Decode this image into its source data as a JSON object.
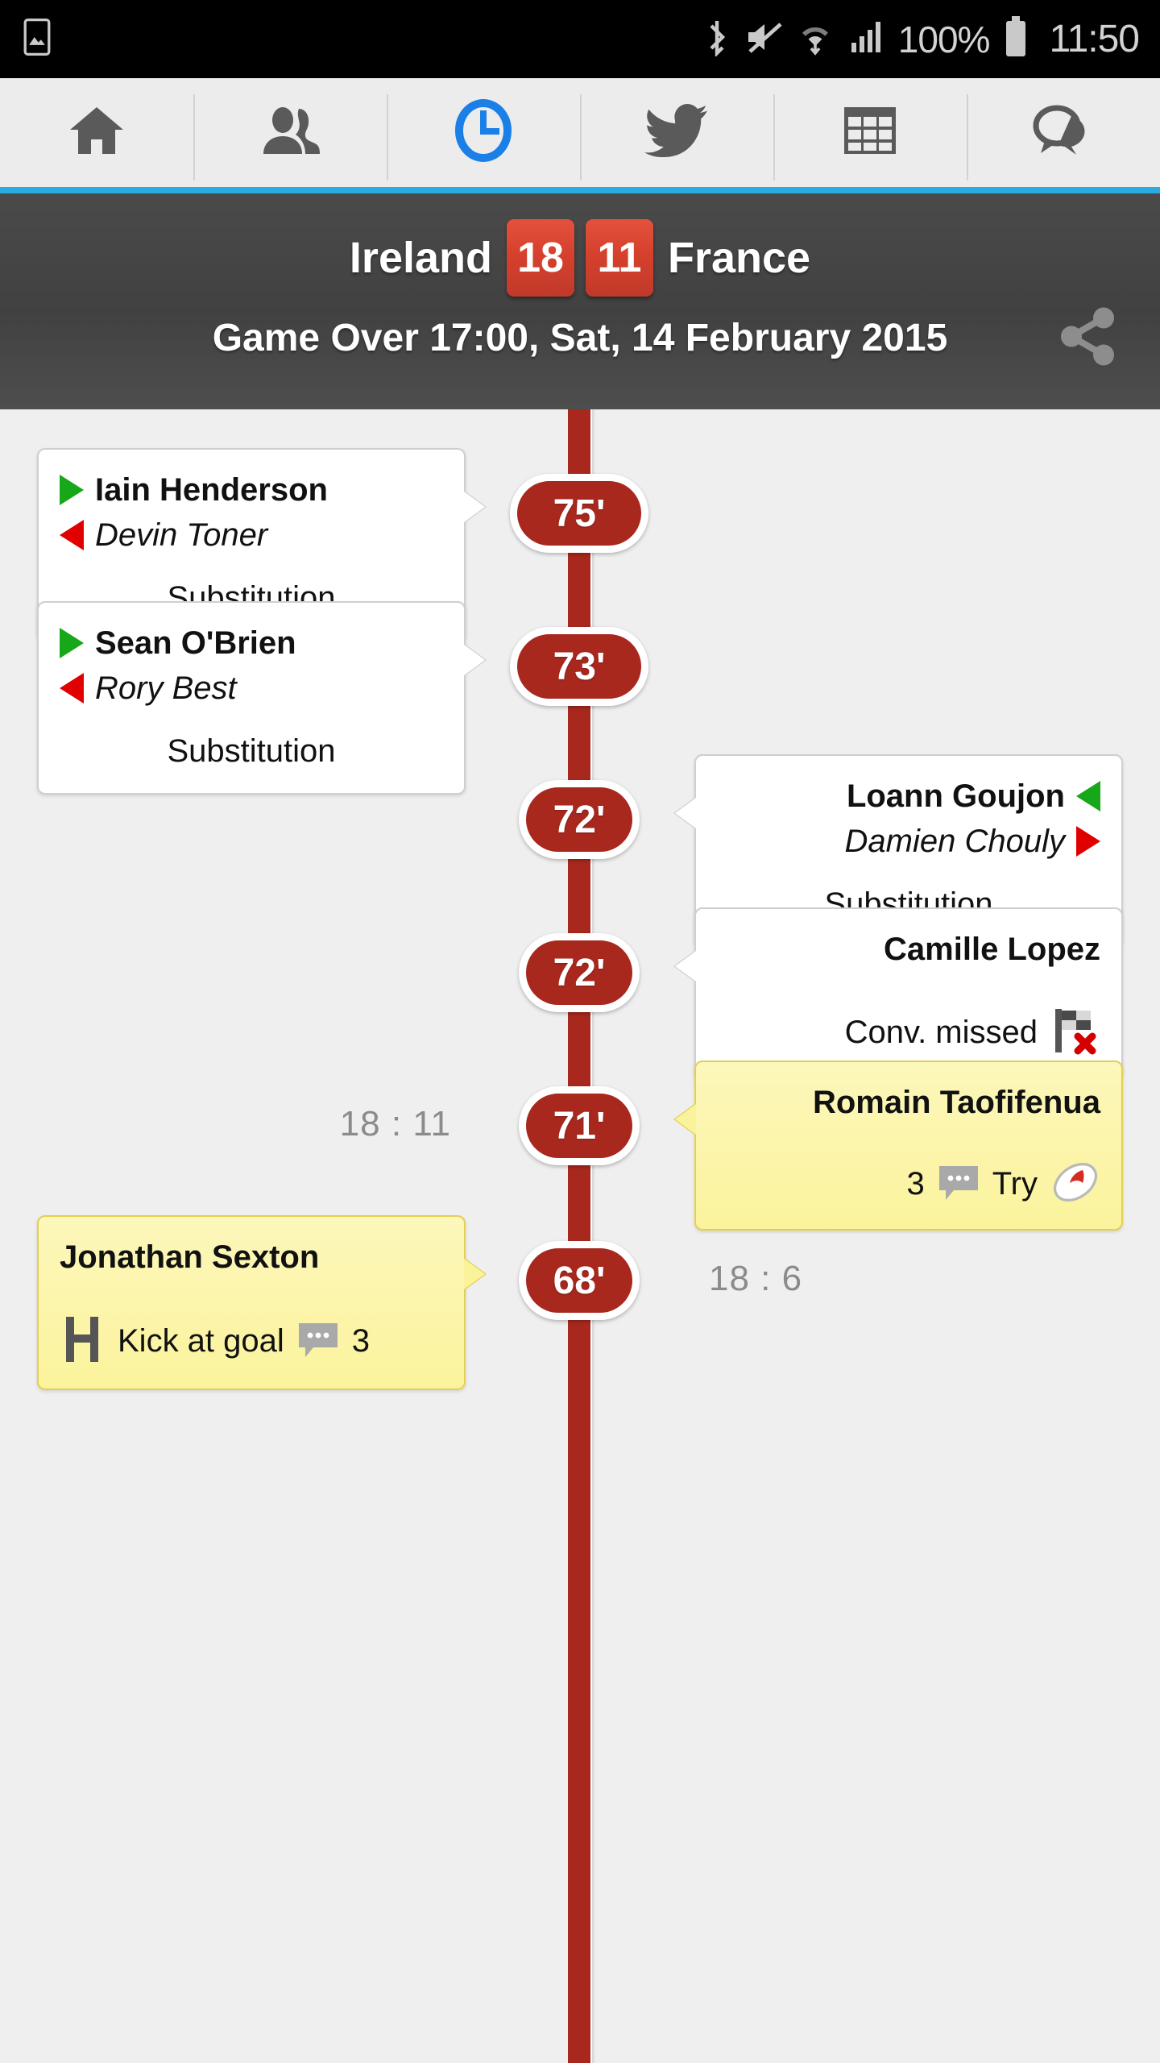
{
  "statusbar": {
    "battery_text": "100%",
    "clock": "11:50",
    "icons": [
      "gallery-icon",
      "bluetooth-icon",
      "mute-icon",
      "wifi-icon",
      "signal-icon",
      "battery-icon"
    ]
  },
  "tabs": [
    {
      "name": "tab-home",
      "icon": "home-icon",
      "active": false
    },
    {
      "name": "tab-lineups",
      "icon": "people-icon",
      "active": false
    },
    {
      "name": "tab-timeline",
      "icon": "clock-icon",
      "active": true
    },
    {
      "name": "tab-twitter",
      "icon": "twitter-icon",
      "active": false
    },
    {
      "name": "tab-table",
      "icon": "table-icon",
      "active": false
    },
    {
      "name": "tab-comments",
      "icon": "chat-icon",
      "active": false
    }
  ],
  "match": {
    "home_team": "Ireland",
    "home_score": "18",
    "away_score": "11",
    "away_team": "France",
    "status": "Game Over 17:00, Sat, 14 February 2015",
    "share_label": "share-icon",
    "accent_red": "#c1392a",
    "header_bg": "#454545"
  },
  "timeline": {
    "spine_color": "#a8281e",
    "events": [
      {
        "minute": "75'",
        "side": "left",
        "type": "substitution",
        "highlight": false,
        "player_in": "Iain Henderson",
        "player_out": "Devin Toner",
        "action": "Substitution",
        "running_score": null,
        "comments": null,
        "icon": null
      },
      {
        "minute": "73'",
        "side": "left",
        "type": "substitution",
        "highlight": false,
        "player_in": "Sean O'Brien",
        "player_out": "Rory Best",
        "action": "Substitution",
        "running_score": null,
        "comments": null,
        "icon": null
      },
      {
        "minute": "72'",
        "side": "right",
        "type": "substitution",
        "highlight": false,
        "player_in": "Loann Goujon",
        "player_out": "Damien Chouly",
        "action": "Substitution",
        "running_score": null,
        "comments": null,
        "icon": null
      },
      {
        "minute": "72'",
        "side": "right",
        "type": "conversion-missed",
        "highlight": false,
        "player_in": "Camille Lopez",
        "player_out": null,
        "action": "Conv. missed",
        "running_score": null,
        "comments": null,
        "icon": "flag-missed-icon"
      },
      {
        "minute": "71'",
        "side": "right",
        "type": "try",
        "highlight": true,
        "player_in": "Romain Taofifenua",
        "player_out": null,
        "action": "Try",
        "running_score": "18 : 11",
        "comments": "3",
        "icon": "rugby-ball-icon"
      },
      {
        "minute": "68'",
        "side": "left",
        "type": "kick-at-goal",
        "highlight": true,
        "player_in": "Jonathan Sexton",
        "player_out": null,
        "action": "Kick at goal",
        "running_score": "18 : 6",
        "comments": "3",
        "icon": "goalpost-icon"
      }
    ]
  }
}
